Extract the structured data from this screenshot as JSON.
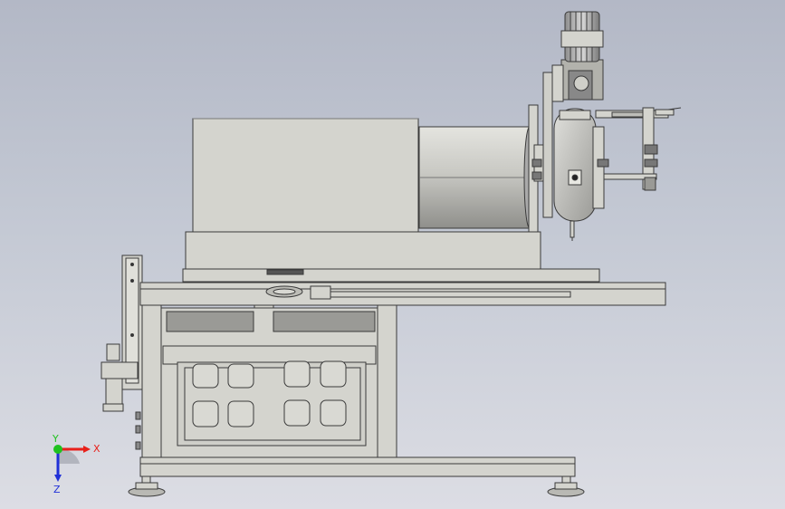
{
  "viewport": {
    "background": "#c4c9d4",
    "part_fill": "#d2d2cc",
    "part_stroke": "#3c3c3c",
    "drum_fill": "#bdbdb8"
  },
  "triad": {
    "x_label": "X",
    "y_label": "Y",
    "z_label": "Z",
    "x_color": "#e8201a",
    "y_color": "#1fc21f",
    "z_color": "#2030d8"
  }
}
